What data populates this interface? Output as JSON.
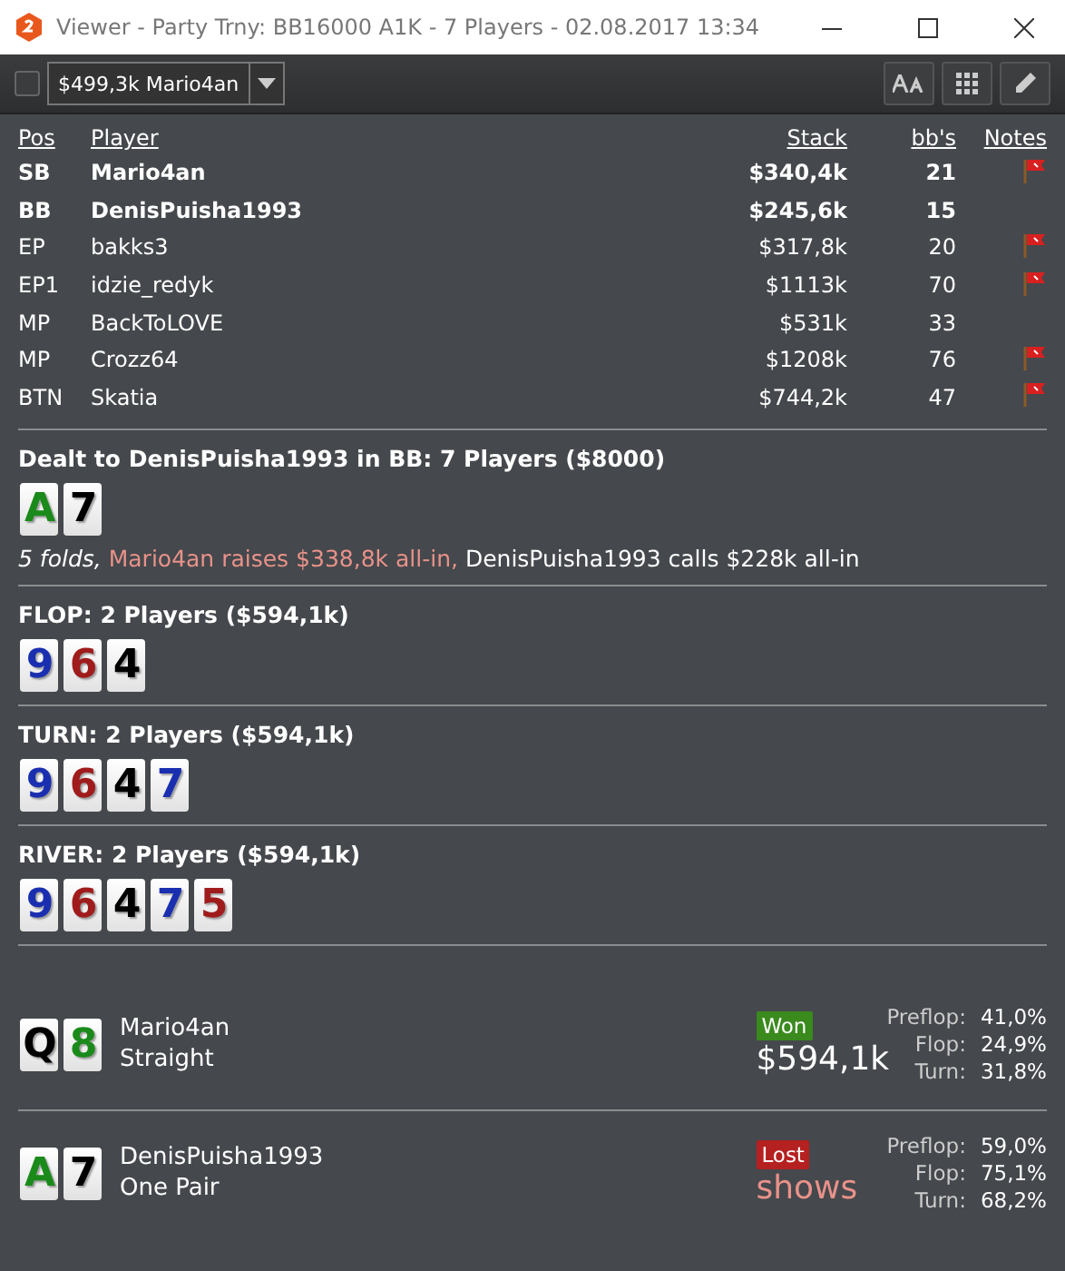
{
  "window": {
    "title": "Viewer - Party Trny: BB16000 A1K - 7 Players - 02.08.2017 13:34"
  },
  "toolbar": {
    "checked": false,
    "selector": "$499,3k Mario4an"
  },
  "table": {
    "columns": [
      "Pos",
      "Player",
      "Stack",
      "bb's",
      "Notes"
    ],
    "rows": [
      {
        "pos": "SB",
        "player": "Mario4an",
        "stack": "$340,4k",
        "bbs": "21",
        "in_hand": true,
        "note": true
      },
      {
        "pos": "BB",
        "player": "DenisPuisha1993",
        "stack": "$245,6k",
        "bbs": "15",
        "in_hand": true,
        "note": false
      },
      {
        "pos": "EP",
        "player": "bakks3",
        "stack": "$317,8k",
        "bbs": "20",
        "in_hand": false,
        "note": true
      },
      {
        "pos": "EP1",
        "player": "idzie_redyk",
        "stack": "$1113k",
        "bbs": "70",
        "in_hand": false,
        "note": true
      },
      {
        "pos": "MP",
        "player": "BackToLOVE",
        "stack": "$531k",
        "bbs": "33",
        "in_hand": false,
        "note": false
      },
      {
        "pos": "MP",
        "player": "Crozz64",
        "stack": "$1208k",
        "bbs": "76",
        "in_hand": false,
        "note": true
      },
      {
        "pos": "BTN",
        "player": "Skatia",
        "stack": "$744,2k",
        "bbs": "47",
        "in_hand": false,
        "note": true
      }
    ]
  },
  "streets": [
    {
      "heading": "Dealt to DenisPuisha1993 in BB: 7 Players ($8000)",
      "cards": [
        {
          "rank": "A",
          "color": "#1a8a1a"
        },
        {
          "rank": "7",
          "color": "#000000"
        }
      ],
      "actions": [
        {
          "kind": "fold",
          "text": "5 folds,"
        },
        {
          "kind": "raise",
          "text": "Mario4an raises $338,8k all-in,"
        },
        {
          "kind": "call",
          "text": "DenisPuisha1993 calls $228k all-in"
        }
      ]
    },
    {
      "heading": "FLOP: 2 Players ($594,1k)",
      "cards": [
        {
          "rank": "9",
          "color": "#1a2fb0"
        },
        {
          "rank": "6",
          "color": "#a01c1c"
        },
        {
          "rank": "4",
          "color": "#000000"
        }
      ]
    },
    {
      "heading": "TURN: 2 Players ($594,1k)",
      "cards": [
        {
          "rank": "9",
          "color": "#1a2fb0"
        },
        {
          "rank": "6",
          "color": "#a01c1c"
        },
        {
          "rank": "4",
          "color": "#000000"
        },
        {
          "rank": "7",
          "color": "#1a2fb0"
        }
      ]
    },
    {
      "heading": "RIVER: 2 Players ($594,1k)",
      "cards": [
        {
          "rank": "9",
          "color": "#1a2fb0"
        },
        {
          "rank": "6",
          "color": "#a01c1c"
        },
        {
          "rank": "4",
          "color": "#000000"
        },
        {
          "rank": "7",
          "color": "#1a2fb0"
        },
        {
          "rank": "5",
          "color": "#a01c1c"
        }
      ]
    }
  ],
  "results": [
    {
      "cards": [
        {
          "rank": "Q",
          "color": "#000000"
        },
        {
          "rank": "8",
          "color": "#1a8a1a"
        }
      ],
      "player": "Mario4an",
      "hand": "Straight",
      "outcome": {
        "kind": "won",
        "label": "Won"
      },
      "amount": "$594,1k",
      "equity": [
        {
          "label": "Preflop:",
          "value": "41,0%"
        },
        {
          "label": "Flop:",
          "value": "24,9%"
        },
        {
          "label": "Turn:",
          "value": "31,8%"
        }
      ]
    },
    {
      "cards": [
        {
          "rank": "A",
          "color": "#1a8a1a"
        },
        {
          "rank": "7",
          "color": "#000000"
        }
      ],
      "player": "DenisPuisha1993",
      "hand": "One Pair",
      "outcome": {
        "kind": "lost",
        "label": "Lost"
      },
      "amount": "shows",
      "equity": [
        {
          "label": "Preflop:",
          "value": "59,0%"
        },
        {
          "label": "Flop:",
          "value": "75,1%"
        },
        {
          "label": "Turn:",
          "value": "68,2%"
        }
      ]
    }
  ]
}
